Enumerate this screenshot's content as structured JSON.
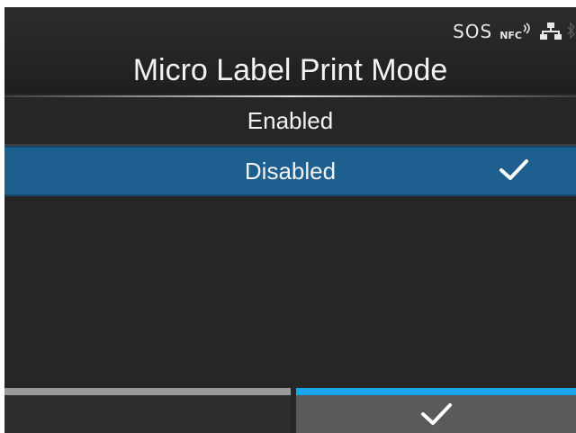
{
  "status": {
    "sos": "SOS",
    "nfc": "NFC",
    "icons": [
      "wifi-waves-icon",
      "network-icon",
      "bluetooth-icon"
    ]
  },
  "screen": {
    "title": "Micro Label Print Mode"
  },
  "options": [
    {
      "label": "Enabled",
      "selected": false
    },
    {
      "label": "Disabled",
      "selected": true
    }
  ],
  "softkeys": {
    "left": {
      "label": ""
    },
    "right": {
      "icon": "checkmark-icon"
    }
  },
  "colors": {
    "background": "#262626",
    "selected_row": "#1d5f8f",
    "left_key_bar": "#9a9a9a",
    "right_key_bar": "#1ba6ec"
  }
}
